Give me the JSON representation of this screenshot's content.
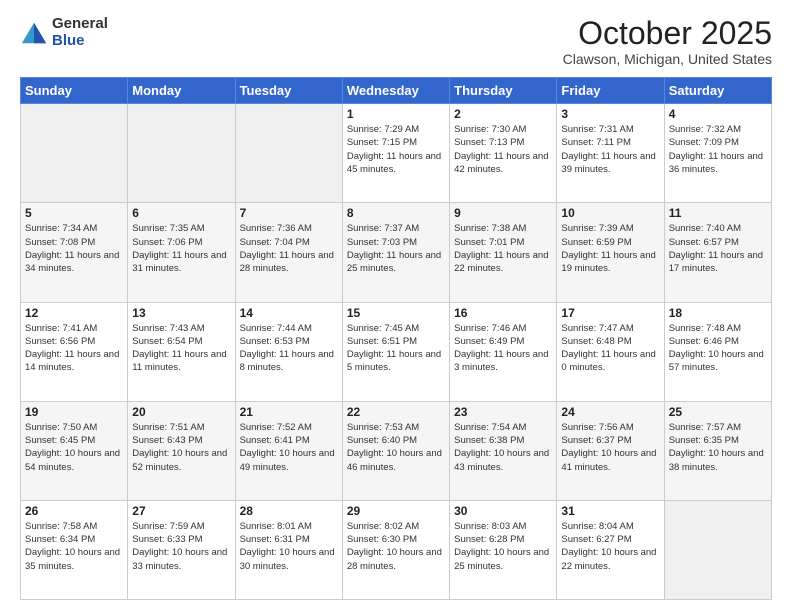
{
  "logo": {
    "general": "General",
    "blue": "Blue"
  },
  "title": "October 2025",
  "subtitle": "Clawson, Michigan, United States",
  "days_of_week": [
    "Sunday",
    "Monday",
    "Tuesday",
    "Wednesday",
    "Thursday",
    "Friday",
    "Saturday"
  ],
  "weeks": [
    [
      {
        "day": "",
        "sunrise": "",
        "sunset": "",
        "daylight": ""
      },
      {
        "day": "",
        "sunrise": "",
        "sunset": "",
        "daylight": ""
      },
      {
        "day": "",
        "sunrise": "",
        "sunset": "",
        "daylight": ""
      },
      {
        "day": "1",
        "sunrise": "Sunrise: 7:29 AM",
        "sunset": "Sunset: 7:15 PM",
        "daylight": "Daylight: 11 hours and 45 minutes."
      },
      {
        "day": "2",
        "sunrise": "Sunrise: 7:30 AM",
        "sunset": "Sunset: 7:13 PM",
        "daylight": "Daylight: 11 hours and 42 minutes."
      },
      {
        "day": "3",
        "sunrise": "Sunrise: 7:31 AM",
        "sunset": "Sunset: 7:11 PM",
        "daylight": "Daylight: 11 hours and 39 minutes."
      },
      {
        "day": "4",
        "sunrise": "Sunrise: 7:32 AM",
        "sunset": "Sunset: 7:09 PM",
        "daylight": "Daylight: 11 hours and 36 minutes."
      }
    ],
    [
      {
        "day": "5",
        "sunrise": "Sunrise: 7:34 AM",
        "sunset": "Sunset: 7:08 PM",
        "daylight": "Daylight: 11 hours and 34 minutes."
      },
      {
        "day": "6",
        "sunrise": "Sunrise: 7:35 AM",
        "sunset": "Sunset: 7:06 PM",
        "daylight": "Daylight: 11 hours and 31 minutes."
      },
      {
        "day": "7",
        "sunrise": "Sunrise: 7:36 AM",
        "sunset": "Sunset: 7:04 PM",
        "daylight": "Daylight: 11 hours and 28 minutes."
      },
      {
        "day": "8",
        "sunrise": "Sunrise: 7:37 AM",
        "sunset": "Sunset: 7:03 PM",
        "daylight": "Daylight: 11 hours and 25 minutes."
      },
      {
        "day": "9",
        "sunrise": "Sunrise: 7:38 AM",
        "sunset": "Sunset: 7:01 PM",
        "daylight": "Daylight: 11 hours and 22 minutes."
      },
      {
        "day": "10",
        "sunrise": "Sunrise: 7:39 AM",
        "sunset": "Sunset: 6:59 PM",
        "daylight": "Daylight: 11 hours and 19 minutes."
      },
      {
        "day": "11",
        "sunrise": "Sunrise: 7:40 AM",
        "sunset": "Sunset: 6:57 PM",
        "daylight": "Daylight: 11 hours and 17 minutes."
      }
    ],
    [
      {
        "day": "12",
        "sunrise": "Sunrise: 7:41 AM",
        "sunset": "Sunset: 6:56 PM",
        "daylight": "Daylight: 11 hours and 14 minutes."
      },
      {
        "day": "13",
        "sunrise": "Sunrise: 7:43 AM",
        "sunset": "Sunset: 6:54 PM",
        "daylight": "Daylight: 11 hours and 11 minutes."
      },
      {
        "day": "14",
        "sunrise": "Sunrise: 7:44 AM",
        "sunset": "Sunset: 6:53 PM",
        "daylight": "Daylight: 11 hours and 8 minutes."
      },
      {
        "day": "15",
        "sunrise": "Sunrise: 7:45 AM",
        "sunset": "Sunset: 6:51 PM",
        "daylight": "Daylight: 11 hours and 5 minutes."
      },
      {
        "day": "16",
        "sunrise": "Sunrise: 7:46 AM",
        "sunset": "Sunset: 6:49 PM",
        "daylight": "Daylight: 11 hours and 3 minutes."
      },
      {
        "day": "17",
        "sunrise": "Sunrise: 7:47 AM",
        "sunset": "Sunset: 6:48 PM",
        "daylight": "Daylight: 11 hours and 0 minutes."
      },
      {
        "day": "18",
        "sunrise": "Sunrise: 7:48 AM",
        "sunset": "Sunset: 6:46 PM",
        "daylight": "Daylight: 10 hours and 57 minutes."
      }
    ],
    [
      {
        "day": "19",
        "sunrise": "Sunrise: 7:50 AM",
        "sunset": "Sunset: 6:45 PM",
        "daylight": "Daylight: 10 hours and 54 minutes."
      },
      {
        "day": "20",
        "sunrise": "Sunrise: 7:51 AM",
        "sunset": "Sunset: 6:43 PM",
        "daylight": "Daylight: 10 hours and 52 minutes."
      },
      {
        "day": "21",
        "sunrise": "Sunrise: 7:52 AM",
        "sunset": "Sunset: 6:41 PM",
        "daylight": "Daylight: 10 hours and 49 minutes."
      },
      {
        "day": "22",
        "sunrise": "Sunrise: 7:53 AM",
        "sunset": "Sunset: 6:40 PM",
        "daylight": "Daylight: 10 hours and 46 minutes."
      },
      {
        "day": "23",
        "sunrise": "Sunrise: 7:54 AM",
        "sunset": "Sunset: 6:38 PM",
        "daylight": "Daylight: 10 hours and 43 minutes."
      },
      {
        "day": "24",
        "sunrise": "Sunrise: 7:56 AM",
        "sunset": "Sunset: 6:37 PM",
        "daylight": "Daylight: 10 hours and 41 minutes."
      },
      {
        "day": "25",
        "sunrise": "Sunrise: 7:57 AM",
        "sunset": "Sunset: 6:35 PM",
        "daylight": "Daylight: 10 hours and 38 minutes."
      }
    ],
    [
      {
        "day": "26",
        "sunrise": "Sunrise: 7:58 AM",
        "sunset": "Sunset: 6:34 PM",
        "daylight": "Daylight: 10 hours and 35 minutes."
      },
      {
        "day": "27",
        "sunrise": "Sunrise: 7:59 AM",
        "sunset": "Sunset: 6:33 PM",
        "daylight": "Daylight: 10 hours and 33 minutes."
      },
      {
        "day": "28",
        "sunrise": "Sunrise: 8:01 AM",
        "sunset": "Sunset: 6:31 PM",
        "daylight": "Daylight: 10 hours and 30 minutes."
      },
      {
        "day": "29",
        "sunrise": "Sunrise: 8:02 AM",
        "sunset": "Sunset: 6:30 PM",
        "daylight": "Daylight: 10 hours and 28 minutes."
      },
      {
        "day": "30",
        "sunrise": "Sunrise: 8:03 AM",
        "sunset": "Sunset: 6:28 PM",
        "daylight": "Daylight: 10 hours and 25 minutes."
      },
      {
        "day": "31",
        "sunrise": "Sunrise: 8:04 AM",
        "sunset": "Sunset: 6:27 PM",
        "daylight": "Daylight: 10 hours and 22 minutes."
      },
      {
        "day": "",
        "sunrise": "",
        "sunset": "",
        "daylight": ""
      }
    ]
  ]
}
